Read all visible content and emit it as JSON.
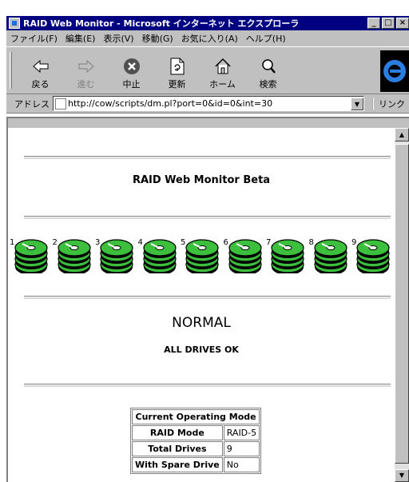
{
  "window": {
    "title": "RAID Web Monitor - Microsoft インターネット エクスプローラ",
    "controls": [
      "_",
      "□",
      "×"
    ]
  },
  "menu": [
    "ファイル(F)",
    "編集(E)",
    "表示(V)",
    "移動(G)",
    "お気に入り(A)",
    "ヘルプ(H)"
  ],
  "toolbar": {
    "buttons": [
      {
        "label": "戻る",
        "icon": "back-arrow-icon",
        "enabled": true
      },
      {
        "label": "進む",
        "icon": "forward-arrow-icon",
        "enabled": false
      },
      {
        "label": "中止",
        "icon": "stop-icon",
        "enabled": true
      },
      {
        "label": "更新",
        "icon": "refresh-icon",
        "enabled": true
      },
      {
        "label": "ホーム",
        "icon": "home-icon",
        "enabled": true
      },
      {
        "label": "検索",
        "icon": "search-icon",
        "enabled": true
      }
    ]
  },
  "address": {
    "label": "アドレス",
    "url": "http://cow/scripts/dm.pl?port=0&id=0&int=30",
    "links_label": "リンク"
  },
  "page": {
    "heading": "RAID Web Monitor Beta",
    "drives": [
      "1",
      "2",
      "3",
      "4",
      "5",
      "6",
      "7",
      "8",
      "9"
    ],
    "drive_color": "#3cbf3c",
    "status": "NORMAL",
    "status_detail": "ALL DRIVES OK",
    "mode_table": {
      "header": "Current Operating Mode",
      "rows": [
        {
          "key": "RAID Mode",
          "value": "RAID-5"
        },
        {
          "key": "Total Drives",
          "value": "9"
        },
        {
          "key": "With Spare Drive",
          "value": "No"
        }
      ]
    }
  },
  "colors": {
    "titlebar": "#000080",
    "chrome": "#c0c0c0",
    "drive_green": "#3cbf3c"
  }
}
